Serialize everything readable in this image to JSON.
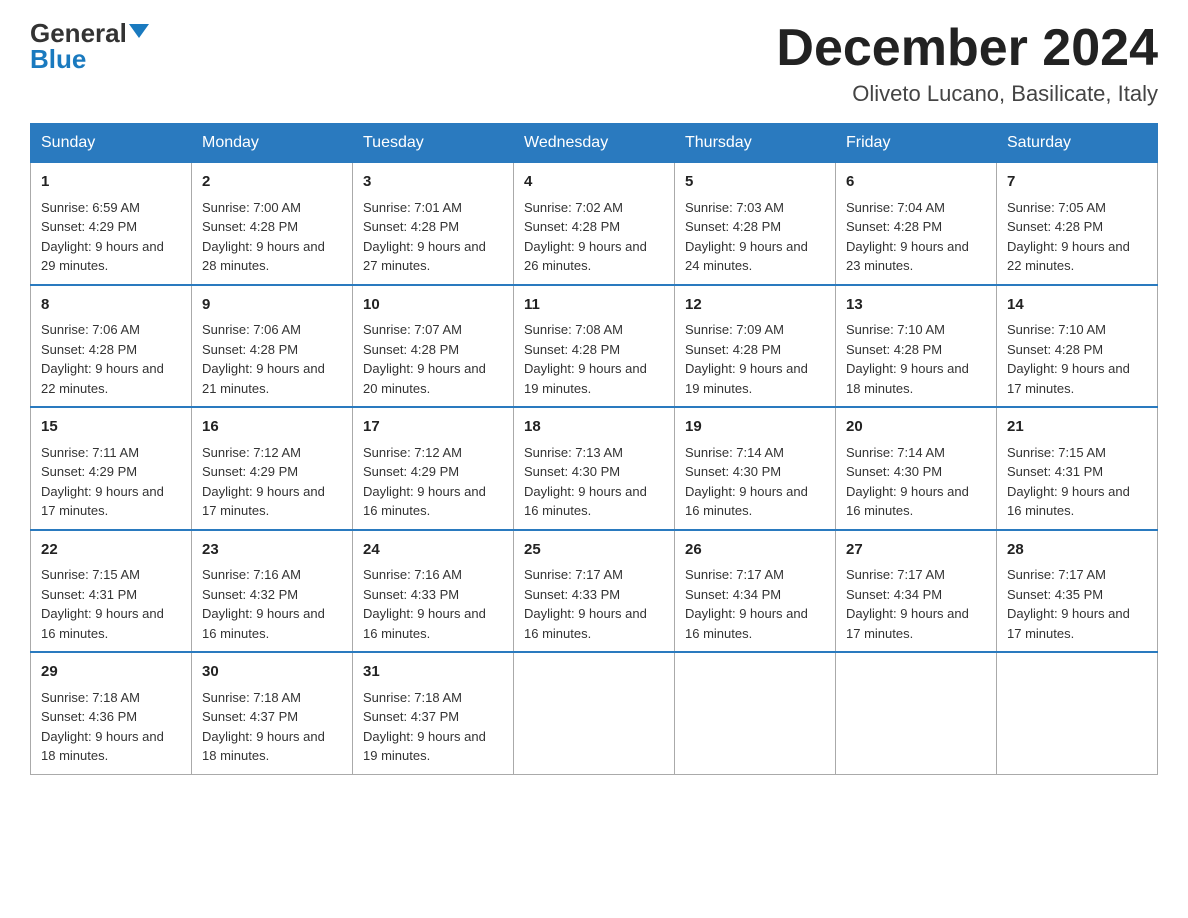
{
  "header": {
    "logo_general": "General",
    "logo_blue": "Blue",
    "month_title": "December 2024",
    "location": "Oliveto Lucano, Basilicate, Italy"
  },
  "weekdays": [
    "Sunday",
    "Monday",
    "Tuesday",
    "Wednesday",
    "Thursday",
    "Friday",
    "Saturday"
  ],
  "weeks": [
    [
      {
        "day": "1",
        "sunrise": "6:59 AM",
        "sunset": "4:29 PM",
        "daylight": "9 hours and 29 minutes."
      },
      {
        "day": "2",
        "sunrise": "7:00 AM",
        "sunset": "4:28 PM",
        "daylight": "9 hours and 28 minutes."
      },
      {
        "day": "3",
        "sunrise": "7:01 AM",
        "sunset": "4:28 PM",
        "daylight": "9 hours and 27 minutes."
      },
      {
        "day": "4",
        "sunrise": "7:02 AM",
        "sunset": "4:28 PM",
        "daylight": "9 hours and 26 minutes."
      },
      {
        "day": "5",
        "sunrise": "7:03 AM",
        "sunset": "4:28 PM",
        "daylight": "9 hours and 24 minutes."
      },
      {
        "day": "6",
        "sunrise": "7:04 AM",
        "sunset": "4:28 PM",
        "daylight": "9 hours and 23 minutes."
      },
      {
        "day": "7",
        "sunrise": "7:05 AM",
        "sunset": "4:28 PM",
        "daylight": "9 hours and 22 minutes."
      }
    ],
    [
      {
        "day": "8",
        "sunrise": "7:06 AM",
        "sunset": "4:28 PM",
        "daylight": "9 hours and 22 minutes."
      },
      {
        "day": "9",
        "sunrise": "7:06 AM",
        "sunset": "4:28 PM",
        "daylight": "9 hours and 21 minutes."
      },
      {
        "day": "10",
        "sunrise": "7:07 AM",
        "sunset": "4:28 PM",
        "daylight": "9 hours and 20 minutes."
      },
      {
        "day": "11",
        "sunrise": "7:08 AM",
        "sunset": "4:28 PM",
        "daylight": "9 hours and 19 minutes."
      },
      {
        "day": "12",
        "sunrise": "7:09 AM",
        "sunset": "4:28 PM",
        "daylight": "9 hours and 19 minutes."
      },
      {
        "day": "13",
        "sunrise": "7:10 AM",
        "sunset": "4:28 PM",
        "daylight": "9 hours and 18 minutes."
      },
      {
        "day": "14",
        "sunrise": "7:10 AM",
        "sunset": "4:28 PM",
        "daylight": "9 hours and 17 minutes."
      }
    ],
    [
      {
        "day": "15",
        "sunrise": "7:11 AM",
        "sunset": "4:29 PM",
        "daylight": "9 hours and 17 minutes."
      },
      {
        "day": "16",
        "sunrise": "7:12 AM",
        "sunset": "4:29 PM",
        "daylight": "9 hours and 17 minutes."
      },
      {
        "day": "17",
        "sunrise": "7:12 AM",
        "sunset": "4:29 PM",
        "daylight": "9 hours and 16 minutes."
      },
      {
        "day": "18",
        "sunrise": "7:13 AM",
        "sunset": "4:30 PM",
        "daylight": "9 hours and 16 minutes."
      },
      {
        "day": "19",
        "sunrise": "7:14 AM",
        "sunset": "4:30 PM",
        "daylight": "9 hours and 16 minutes."
      },
      {
        "day": "20",
        "sunrise": "7:14 AM",
        "sunset": "4:30 PM",
        "daylight": "9 hours and 16 minutes."
      },
      {
        "day": "21",
        "sunrise": "7:15 AM",
        "sunset": "4:31 PM",
        "daylight": "9 hours and 16 minutes."
      }
    ],
    [
      {
        "day": "22",
        "sunrise": "7:15 AM",
        "sunset": "4:31 PM",
        "daylight": "9 hours and 16 minutes."
      },
      {
        "day": "23",
        "sunrise": "7:16 AM",
        "sunset": "4:32 PM",
        "daylight": "9 hours and 16 minutes."
      },
      {
        "day": "24",
        "sunrise": "7:16 AM",
        "sunset": "4:33 PM",
        "daylight": "9 hours and 16 minutes."
      },
      {
        "day": "25",
        "sunrise": "7:17 AM",
        "sunset": "4:33 PM",
        "daylight": "9 hours and 16 minutes."
      },
      {
        "day": "26",
        "sunrise": "7:17 AM",
        "sunset": "4:34 PM",
        "daylight": "9 hours and 16 minutes."
      },
      {
        "day": "27",
        "sunrise": "7:17 AM",
        "sunset": "4:34 PM",
        "daylight": "9 hours and 17 minutes."
      },
      {
        "day": "28",
        "sunrise": "7:17 AM",
        "sunset": "4:35 PM",
        "daylight": "9 hours and 17 minutes."
      }
    ],
    [
      {
        "day": "29",
        "sunrise": "7:18 AM",
        "sunset": "4:36 PM",
        "daylight": "9 hours and 18 minutes."
      },
      {
        "day": "30",
        "sunrise": "7:18 AM",
        "sunset": "4:37 PM",
        "daylight": "9 hours and 18 minutes."
      },
      {
        "day": "31",
        "sunrise": "7:18 AM",
        "sunset": "4:37 PM",
        "daylight": "9 hours and 19 minutes."
      },
      null,
      null,
      null,
      null
    ]
  ]
}
